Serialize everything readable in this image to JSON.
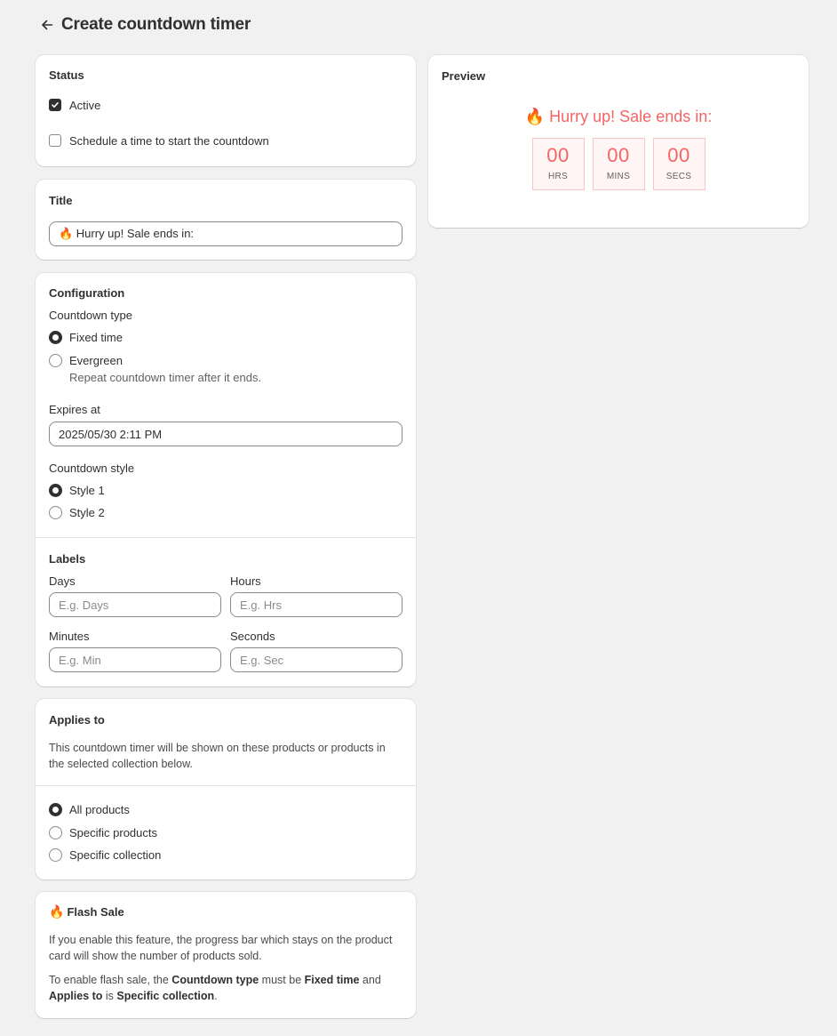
{
  "header": {
    "title": "Create countdown timer"
  },
  "status": {
    "title": "Status",
    "active_label": "Active",
    "active_checked": true,
    "schedule_label": "Schedule a time to start the countdown",
    "schedule_checked": false
  },
  "title_card": {
    "title": "Title",
    "value": "🔥 Hurry up! Sale ends in:"
  },
  "configuration": {
    "title": "Configuration",
    "countdown_type_label": "Countdown type",
    "type_options": [
      {
        "label": "Fixed time",
        "selected": true
      },
      {
        "label": "Evergreen",
        "selected": false,
        "help": "Repeat countdown timer after it ends."
      }
    ],
    "expires_label": "Expires at",
    "expires_value": "2025/05/30 2:11 PM",
    "style_label": "Countdown style",
    "style_options": [
      {
        "label": "Style 1",
        "selected": true
      },
      {
        "label": "Style 2",
        "selected": false
      }
    ]
  },
  "labels": {
    "title": "Labels",
    "days_label": "Days",
    "days_placeholder": "E.g. Days",
    "hours_label": "Hours",
    "hours_placeholder": "E.g. Hrs",
    "minutes_label": "Minutes",
    "minutes_placeholder": "E.g. Min",
    "seconds_label": "Seconds",
    "seconds_placeholder": "E.g. Sec"
  },
  "applies_to": {
    "title": "Applies to",
    "description": "This countdown timer will be shown on these products or products in the selected collection below.",
    "options": [
      {
        "label": "All products",
        "selected": true
      },
      {
        "label": "Specific products",
        "selected": false
      },
      {
        "label": "Specific collection",
        "selected": false
      }
    ]
  },
  "flash_sale": {
    "icon": "fire-icon",
    "title": "Flash Sale",
    "paragraph1": "If you enable this feature, the progress bar which stays on the product card will show the number of products sold.",
    "p2_a": "To enable flash sale, the ",
    "p2_b": "Countdown type",
    "p2_c": " must be ",
    "p2_d": "Fixed time",
    "p2_e": " and",
    "p2_f": "Applies to",
    "p2_g": " is ",
    "p2_h": "Specific collection",
    "p2_i": "."
  },
  "preview": {
    "title": "Preview",
    "heading": "🔥 Hurry up! Sale ends in:",
    "units": [
      {
        "value": "00",
        "label": "HRS"
      },
      {
        "value": "00",
        "label": "MINS"
      },
      {
        "value": "00",
        "label": "SECS"
      }
    ]
  },
  "colors": {
    "accent_red": "#f56565",
    "timer_border": "#f8c7c3",
    "timer_bg": "#fff5f4",
    "page_bg": "#f1f1f1",
    "text": "#303030"
  }
}
